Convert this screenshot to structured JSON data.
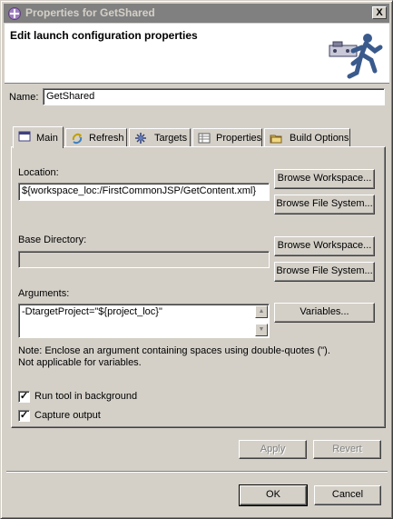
{
  "window": {
    "title": "Properties for GetShared",
    "close_label": "X"
  },
  "header": {
    "heading": "Edit launch configuration properties"
  },
  "name": {
    "label": "Name:",
    "value": "GetShared"
  },
  "tabs": [
    {
      "label": "Main",
      "icon": "main-tab-icon",
      "active": true
    },
    {
      "label": "Refresh",
      "icon": "refresh-icon"
    },
    {
      "label": "Targets",
      "icon": "targets-icon"
    },
    {
      "label": "Properties",
      "icon": "properties-table-icon"
    },
    {
      "label": "Build Options",
      "icon": "build-options-icon"
    }
  ],
  "location": {
    "label": "Location:",
    "value": "${workspace_loc:/FirstCommonJSP/GetContent.xml}",
    "browse_workspace": "Browse Workspace...",
    "browse_file_system": "Browse File System..."
  },
  "base_directory": {
    "label": "Base Directory:",
    "value": "",
    "browse_workspace": "Browse Workspace...",
    "browse_file_system": "Browse File System..."
  },
  "arguments": {
    "label": "Arguments:",
    "value": "-DtargetProject=\"${project_loc}\"",
    "variables_button": "Variables...",
    "note_line1": "Note: Enclose an argument containing spaces using double-quotes (\").",
    "note_line2": "Not applicable for variables."
  },
  "options": {
    "run_in_background": {
      "label": "Run tool in background",
      "checked": true
    },
    "capture_output": {
      "label": "Capture output",
      "checked": true
    }
  },
  "buttons": {
    "apply": "Apply",
    "revert": "Revert",
    "ok": "OK",
    "cancel": "Cancel"
  },
  "colors": {
    "face": "#d4d0c8",
    "titlebar_inactive": "#808080",
    "banner_figure": "#3a5a8c"
  }
}
